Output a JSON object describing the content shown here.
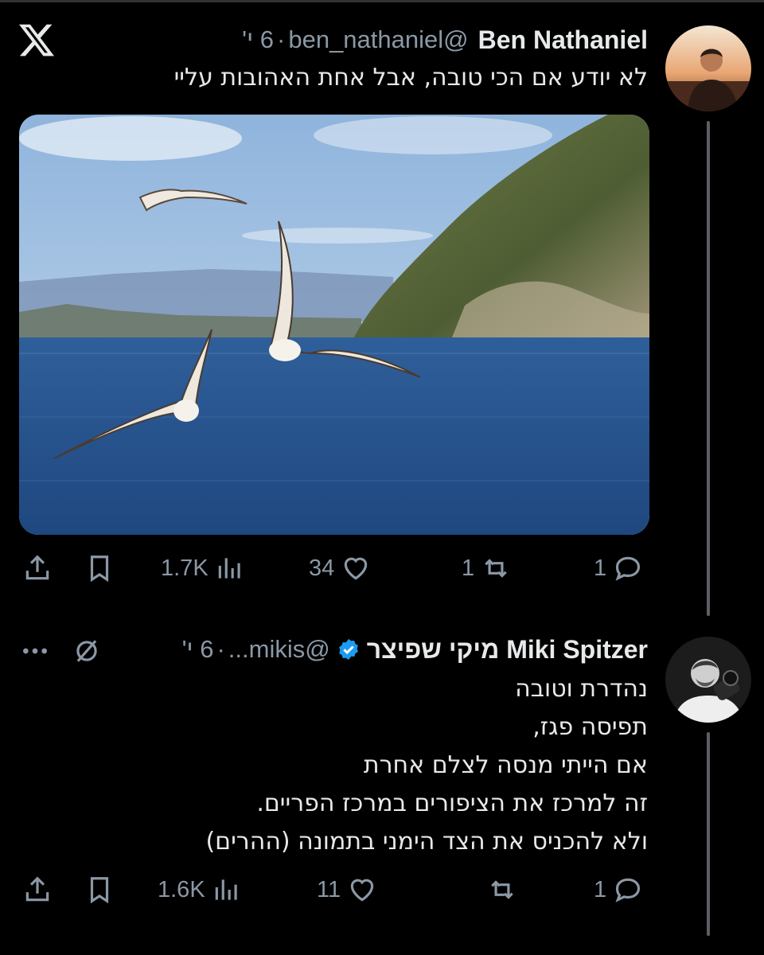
{
  "app": {
    "logo": "x-logo"
  },
  "tweet1": {
    "author_name": "Ben Nathaniel",
    "handle": "@ben_nathaniel",
    "time": "6 י'",
    "separator": "·",
    "text": "לא יודע אם הכי טובה, אבל אחת האהובות עליי",
    "stats": {
      "views": "1.7K",
      "likes": "34",
      "reposts": "1",
      "replies": "1"
    }
  },
  "tweet2": {
    "author_name": "Miki Spitzer מיקי שפיצר",
    "handle": "@mikis...",
    "time": "6 י'",
    "separator": "·",
    "verified": true,
    "text_lines": [
      "נהדרת וטובה",
      "תפיסה פגז,",
      "אם הייתי מנסה לצלם אחרת",
      "זה למרכז את הציפורים במרכז הפריים.",
      "ולא להכניס את הצד הימני בתמונה (ההרים)"
    ],
    "stats": {
      "views": "1.6K",
      "likes": "11",
      "reposts": "",
      "replies": "1"
    }
  },
  "colors": {
    "background": "#000000",
    "text": "#e7e9ea",
    "muted": "#8b98a5",
    "verified": "#1d9bf0"
  }
}
